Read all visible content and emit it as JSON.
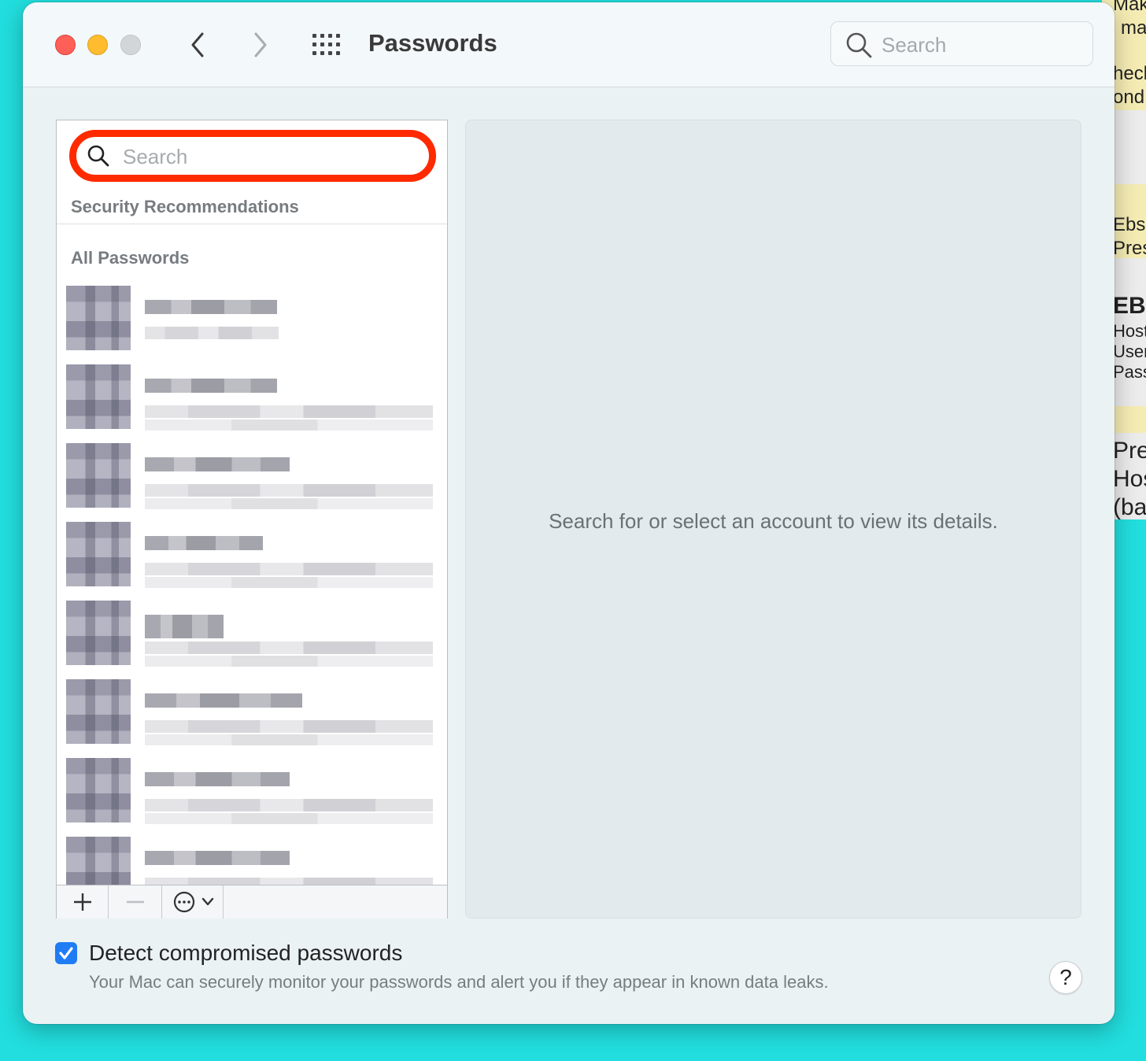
{
  "window": {
    "title": "Passwords",
    "toolbar_search_placeholder": "Search"
  },
  "sidebar": {
    "search_placeholder": "Search",
    "security_recommendations_label": "Security Recommendations",
    "all_passwords_label": "All Passwords",
    "rows": [
      {
        "name": "",
        "user": ""
      },
      {
        "name": "",
        "user": ""
      },
      {
        "name": "",
        "user": ""
      },
      {
        "name": "",
        "user": ""
      },
      {
        "name": "",
        "user": ""
      },
      {
        "name": "",
        "user": ""
      },
      {
        "name": "",
        "user": ""
      },
      {
        "name": "",
        "user": ""
      }
    ],
    "toolbar": {
      "add_icon": "plus-icon",
      "remove_icon": "minus-icon",
      "more_icon": "ellipsis-circle-icon"
    }
  },
  "detail": {
    "empty_message": "Search for or select an account to view its details."
  },
  "footer": {
    "detect_checked": true,
    "detect_label": "Detect compromised passwords",
    "detect_description": "Your Mac can securely monitor your passwords and alert you if they appear in known data leaks.",
    "help_label": "?"
  },
  "background_window": {
    "lines": [
      "Make",
      "ma",
      "heck",
      "ond",
      "Ebs",
      "Pres",
      "EB",
      "Host",
      "User",
      "Pass",
      "Pre",
      "Hos",
      "(ba"
    ]
  },
  "colors": {
    "desktop": "#22dede",
    "highlight_ring": "#ff2a00",
    "checkbox": "#1f7cf5"
  }
}
